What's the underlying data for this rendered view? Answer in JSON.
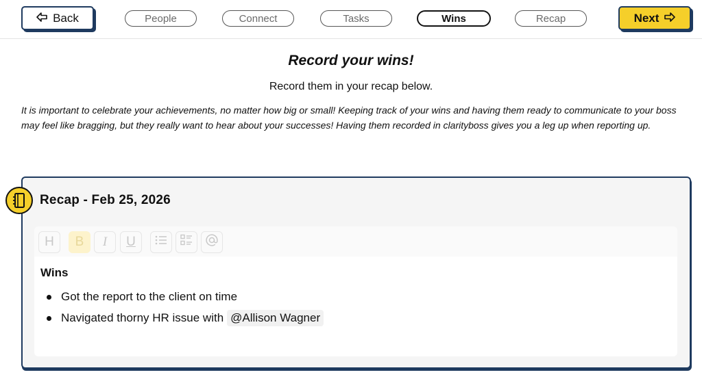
{
  "nav": {
    "back_label": "Back",
    "next_label": "Next",
    "steps": [
      {
        "label": "People",
        "active": false
      },
      {
        "label": "Connect",
        "active": false
      },
      {
        "label": "Tasks",
        "active": false
      },
      {
        "label": "Wins",
        "active": true
      },
      {
        "label": "Recap",
        "active": false
      }
    ]
  },
  "main": {
    "heading": "Record your wins!",
    "subheading": "Record them in your recap below.",
    "intro": "It is important to celebrate your achievements, no matter how big or small! Keeping track of your wins and having them ready to communicate to your boss may feel like bragging, but they really want to hear about your successes! Having them recorded in clarityboss gives you a leg up when reporting up."
  },
  "recap": {
    "title": "Recap - Feb 25, 2026",
    "toolbar": {
      "heading": "H",
      "bold": "B",
      "italic": "I",
      "underline": "U"
    },
    "section_heading": "Wins",
    "items": [
      {
        "text": "Got the report to the client on time"
      },
      {
        "text": "Navigated thorny HR issue with",
        "mention": "@Allison Wagner"
      }
    ]
  },
  "colors": {
    "accent": "#f5cf2a",
    "navy": "#1e3a5f"
  }
}
